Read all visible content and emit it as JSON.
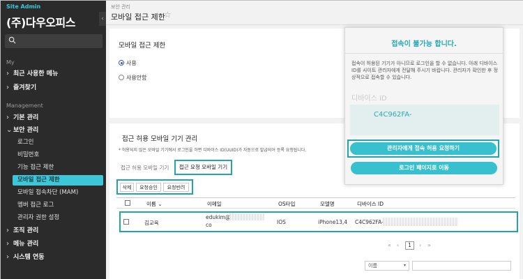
{
  "sidebar": {
    "site_label": "Site Admin",
    "org_name": "(주)다우오피스",
    "collapse_icon": "‹",
    "section_my": "My",
    "recent_menu": "최근 사용한 메뉴",
    "favorites": "즐겨찾기",
    "section_management": "Management",
    "basic_mgmt": "기본 관리",
    "security_mgmt": "보안 관리",
    "security_sub": [
      "로그인",
      "비밀번호",
      "기능 접근 제한",
      "모바일 접근 제한",
      "모바일 접속차단 (MAM)",
      "멤버 접근 로그",
      "관리자 권한 설정"
    ],
    "org_mgmt": "조직 관리",
    "menu_mgmt": "메뉴 관리",
    "system_link": "시스템 연동",
    "accent": "#3cc6d8"
  },
  "header": {
    "breadcrumb": "보안 관리",
    "title": "모바일 접근 제한",
    "star": "☆"
  },
  "restriction": {
    "heading": "모바일 접근 제한",
    "option_use": "사용",
    "option_unused": "사용안함",
    "selected": "사용"
  },
  "devices": {
    "heading": "접근 허용 모바일 기기 관리",
    "note": "* 허용되지 않은 모바일 기기에서 로그인을 하면 디바이스 ID(UUID)가 자동으로 발급되어 등록 요청됩니다.",
    "tab_allowed": "접근 허용 모바일 기기",
    "tab_requested": "접근 요청 모바일 기기",
    "actions": [
      "삭제",
      "요청승인",
      "요청반려"
    ],
    "columns": [
      "이름",
      "이메일",
      "OS타입",
      "모델명",
      "디바이스 ID"
    ],
    "sort_icon": "⌄",
    "rows": [
      {
        "name": "김교육",
        "email_user": "edukim@",
        "email_tail": "co",
        "os": "IOS",
        "model": "iPhone13,4",
        "device_id": "C4C962FA-"
      }
    ],
    "pager": {
      "first": "«",
      "prev": "‹",
      "current": "1",
      "next": "›",
      "last": "»"
    },
    "search_select": "이름",
    "select_arrow": "▾"
  },
  "popup": {
    "title": "접속이 불가능 합니다.",
    "message": "접속이 허용된 기기가 아니므로 로그인을 할 수 없습니다. 아래 디바이스 ID를 사이트 관리자에게 전달해 주시기 바랍니다. 관리자가 확인한 후 정상적으로 접속할 수 있습니다.",
    "device_id_label": "디바이스 ID",
    "device_id": "C4C962FA-",
    "request_button": "관리자에게 접속 허용 요청하기",
    "login_button": "로그인 페이지로 이동"
  }
}
